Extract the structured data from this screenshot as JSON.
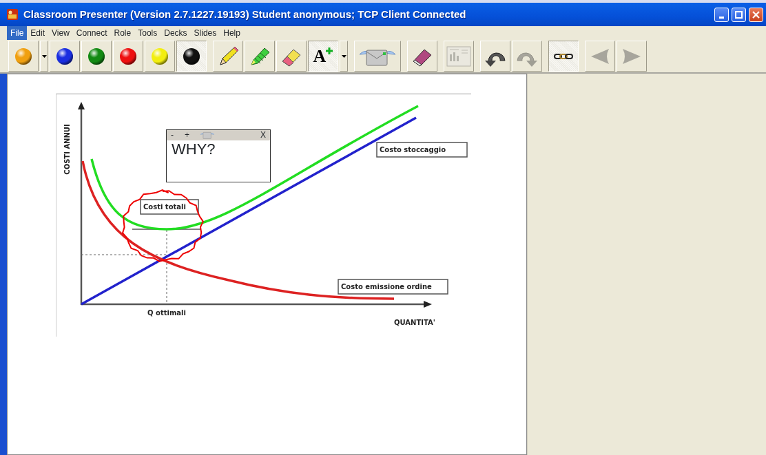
{
  "window": {
    "title": "Classroom Presenter (Version 2.7.1227.19193) Student anonymous; TCP Client Connected"
  },
  "menu": [
    {
      "label": "File",
      "selected": true
    },
    {
      "label": "Edit",
      "selected": false
    },
    {
      "label": "View",
      "selected": false
    },
    {
      "label": "Connect",
      "selected": false
    },
    {
      "label": "Role",
      "selected": false
    },
    {
      "label": "Tools",
      "selected": false
    },
    {
      "label": "Decks",
      "selected": false
    },
    {
      "label": "Slides",
      "selected": false
    },
    {
      "label": "Help",
      "selected": false
    }
  ],
  "toolbar": [
    {
      "buttons": [
        {
          "kind": "pen",
          "color": "#f0a010",
          "selected": false
        },
        {
          "kind": "dropdown"
        },
        {
          "kind": "pen",
          "color": "#1a2ee0",
          "selected": false
        },
        {
          "kind": "pen",
          "color": "#138a13",
          "selected": false
        },
        {
          "kind": "pen",
          "color": "#ee1010",
          "selected": false
        },
        {
          "kind": "pen",
          "color": "#f2ee10",
          "selected": false
        },
        {
          "kind": "pen",
          "color": "#111111",
          "selected": true
        }
      ]
    },
    {
      "buttons": [
        {
          "kind": "pencil",
          "selected": false
        },
        {
          "kind": "highlighter",
          "selected": false
        },
        {
          "kind": "eraser",
          "selected": false
        },
        {
          "kind": "text",
          "label": "A",
          "selected": true
        },
        {
          "kind": "dropdown"
        }
      ]
    },
    {
      "buttons": [
        {
          "kind": "send"
        }
      ]
    },
    {
      "buttons": [
        {
          "kind": "clear"
        }
      ]
    },
    {
      "buttons": [
        {
          "kind": "slide",
          "disabled": true
        }
      ]
    },
    {
      "buttons": [
        {
          "kind": "undo",
          "disabled": false
        },
        {
          "kind": "redo",
          "disabled": true
        }
      ]
    },
    {
      "buttons": [
        {
          "kind": "link",
          "selected": true
        }
      ]
    },
    {
      "buttons": [
        {
          "kind": "back",
          "disabled": true
        },
        {
          "kind": "forward",
          "disabled": true
        }
      ]
    }
  ],
  "slide": {
    "y_axis_label": "COSTI ANNUI",
    "x_axis_label": "QUANTITA'",
    "optimum_label": "Q ottimali",
    "curves": [
      {
        "label": "Costi totali",
        "color": "#22dd22"
      },
      {
        "label": "Costo stoccaggio",
        "color": "#2222cc"
      },
      {
        "label": "Costo emissione ordine",
        "color": "#dd2222"
      }
    ],
    "ink": {
      "color": "#ee0000"
    },
    "note": {
      "minimize": "-",
      "maximize": "+",
      "close": "X",
      "text": "WHY?"
    }
  }
}
